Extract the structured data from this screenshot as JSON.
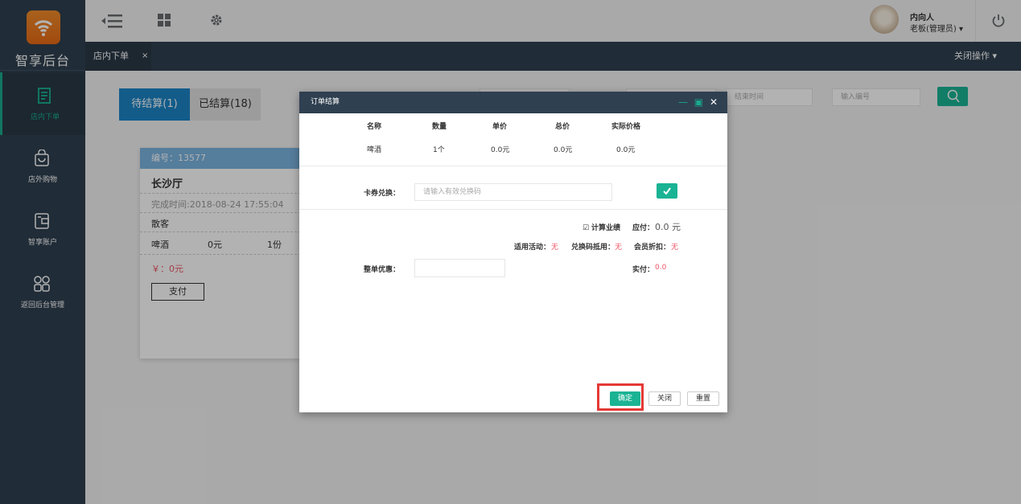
{
  "sidebar": {
    "logo_text": "智享后台",
    "items": [
      {
        "label": "店内下单",
        "icon": "bill-icon"
      },
      {
        "label": "店外购物",
        "icon": "bag-icon"
      },
      {
        "label": "智享账户",
        "icon": "account-icon"
      },
      {
        "label": "返回后台管理",
        "icon": "grid-icon"
      }
    ]
  },
  "topbar": {
    "user_name": "内向人",
    "user_role": "老板(管理员) ▾"
  },
  "tabbar": {
    "active_tab": "店内下单",
    "close_symbol": "×",
    "close_ops": "关闭操作 ▾"
  },
  "main": {
    "subtabs": [
      "待结算(1)",
      "已结算(18)"
    ],
    "end_time_placeholder": "结束时间",
    "search_placeholder": "输入编号",
    "card": {
      "number": "编号：13577",
      "room": "长沙厅",
      "finish_time": "完成时间:2018-08-24 17:55:04",
      "customer": "散客",
      "item_name": "啤酒",
      "item_price": "0元",
      "item_qty": "1份",
      "total": "￥：0元",
      "pay_button": "支付"
    }
  },
  "dialog": {
    "title": "订单结算",
    "headers": [
      "名称",
      "数量",
      "单价",
      "总价",
      "实际价格"
    ],
    "row": [
      "啤酒",
      "1个",
      "0.0元",
      "0.0元",
      "0.0元"
    ],
    "coupon_label": "卡券兑换：",
    "coupon_placeholder": "请输入有效兑换码",
    "calc_performance": "计算业绩",
    "due_label": "应付：",
    "due_value": "0.0 元",
    "activity_label": "适用活动：",
    "activity_value": "无",
    "redeem_label": "兑换码抵用：",
    "redeem_value": "无",
    "member_label": "会员折扣：",
    "member_value": "无",
    "discount_label": "整单优惠：",
    "paid_label": "实付：",
    "paid_value": "0.0",
    "ok_button": "确定",
    "close_button": "关闭",
    "reset_button": "重置"
  },
  "colors": {
    "sidebar": "#2f4050",
    "accent": "#1ab394",
    "tab_blue": "#1c84c6",
    "highlight": "#e53935"
  }
}
